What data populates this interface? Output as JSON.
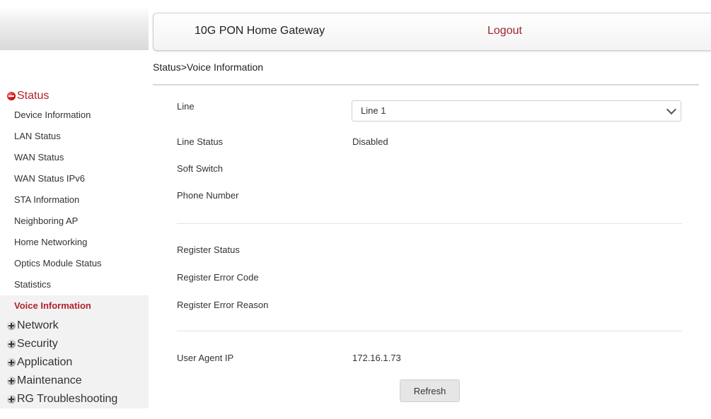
{
  "header": {
    "title": "10G PON Home Gateway",
    "logout_label": "Logout"
  },
  "breadcrumb": "Status>Voice Information",
  "sidebar": {
    "status_group": "Status",
    "status_items": [
      {
        "label": "Device Information"
      },
      {
        "label": "LAN Status"
      },
      {
        "label": "WAN Status"
      },
      {
        "label": "WAN Status IPv6"
      },
      {
        "label": "STA Information"
      },
      {
        "label": "Neighboring AP"
      },
      {
        "label": "Home Networking"
      },
      {
        "label": "Optics Module Status"
      },
      {
        "label": "Statistics"
      },
      {
        "label": "Voice Information"
      }
    ],
    "groups": [
      {
        "label": "Network"
      },
      {
        "label": "Security"
      },
      {
        "label": "Application"
      },
      {
        "label": "Maintenance"
      },
      {
        "label": "RG Troubleshooting"
      }
    ]
  },
  "form": {
    "line_label": "Line",
    "line_value": "Line 1",
    "line_status_label": "Line Status",
    "line_status_value": "Disabled",
    "soft_switch_label": "Soft Switch",
    "soft_switch_value": "",
    "phone_number_label": "Phone Number",
    "phone_number_value": "",
    "register_status_label": "Register Status",
    "register_status_value": "",
    "register_error_code_label": "Register Error Code",
    "register_error_code_value": "",
    "register_error_reason_label": "Register Error Reason",
    "register_error_reason_value": "",
    "user_agent_ip_label": "User Agent IP",
    "user_agent_ip_value": "172.16.1.73",
    "refresh_label": "Refresh"
  },
  "colors": {
    "accent": "#b0232c",
    "sidebar_selected_bg": "#f2f2f2"
  }
}
